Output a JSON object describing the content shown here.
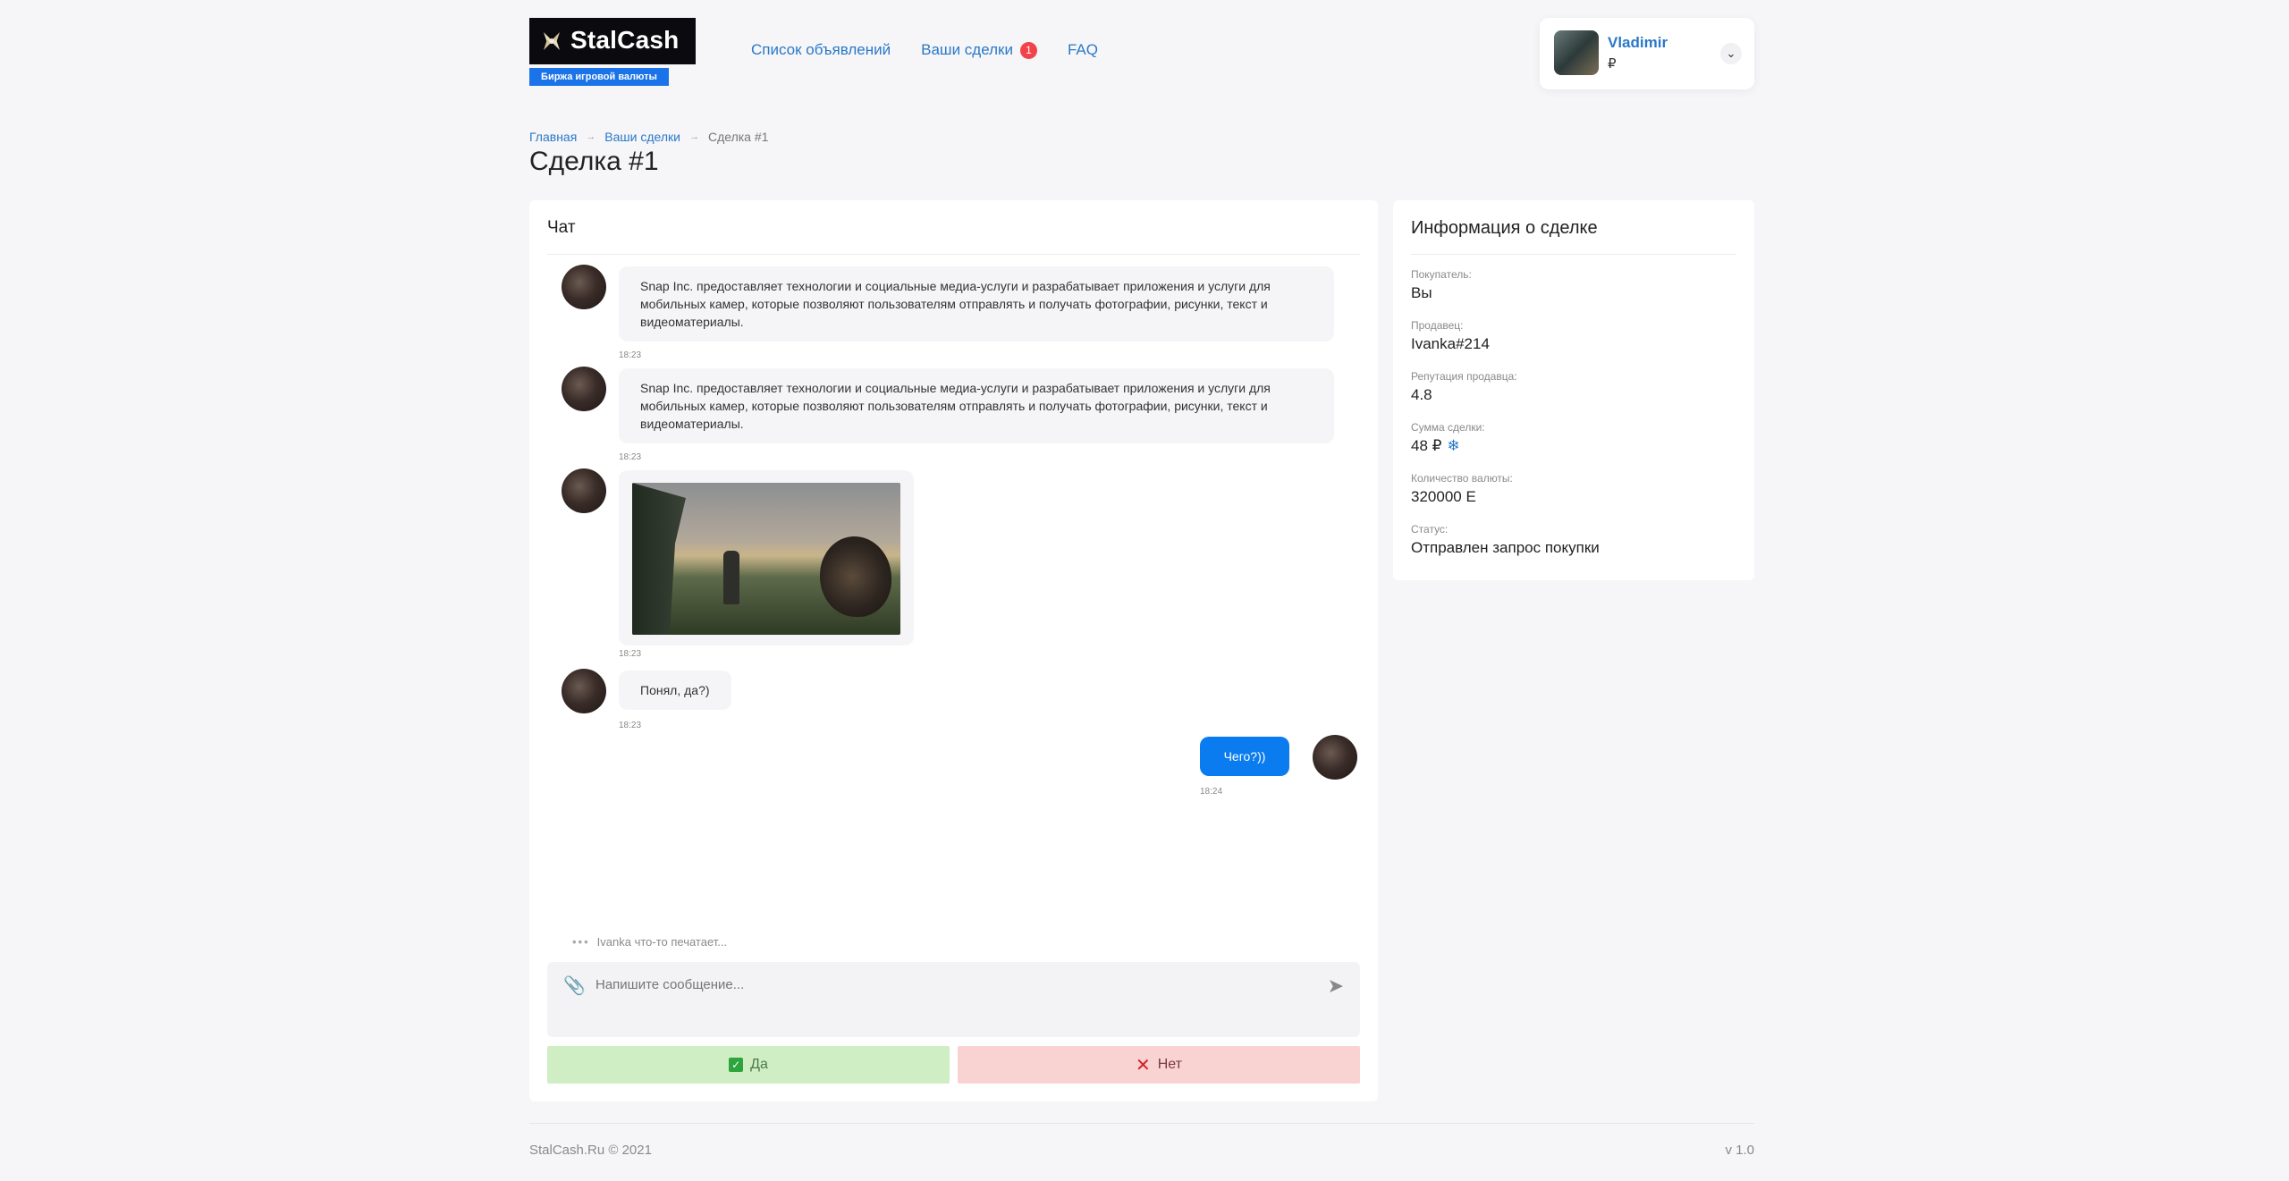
{
  "brand": {
    "name": "StalCash",
    "tagline": "Биржа игровой валюты"
  },
  "nav": {
    "items": [
      {
        "label": "Список объявлений"
      },
      {
        "label": "Ваши сделки",
        "badge": "1"
      },
      {
        "label": "FAQ"
      }
    ]
  },
  "user": {
    "name": "Vladimir",
    "balance": "₽"
  },
  "breadcrumb": {
    "home": "Главная",
    "deals": "Ваши сделки",
    "current": "Сделка #1"
  },
  "page_title": "Сделка #1",
  "chat": {
    "title": "Чат",
    "messages": [
      {
        "text": "Snap Inc. предоставляет технологии и социальные медиа-услуги и разрабатывает приложения и услуги для мобильных камер, которые позволяют пользователям отправлять и получать фотографии, рисунки, текст и видеоматериалы.",
        "time": "18:23"
      },
      {
        "text": "Snap Inc. предоставляет технологии и социальные медиа-услуги и разрабатывает приложения и услуги для мобильных камер, которые позволяют пользователям отправлять и получать фотографии, рисунки, текст и видеоматериалы.",
        "time": "18:23"
      },
      {
        "time": "18:23"
      },
      {
        "text": "Понял, да?)",
        "time": "18:23"
      },
      {
        "text": "Чего?))",
        "time": "18:24"
      }
    ],
    "typing": "Ivanka что-то печатает...",
    "input_placeholder": "Напишите сообщение...",
    "yes_label": "Да",
    "no_label": "Нет"
  },
  "deal_info": {
    "title": "Информация о сделке",
    "buyer_label": "Покупатель:",
    "buyer": "Вы",
    "seller_label": "Продавец:",
    "seller": "Ivanka#214",
    "reputation_label": "Репутация продавца:",
    "reputation": "4.8",
    "amount_label": "Сумма сделки:",
    "amount": "48 ₽",
    "currency_label": "Количество валюты:",
    "currency": "320000 E",
    "status_label": "Статус:",
    "status": "Отправлен запрос покупки"
  },
  "footer": {
    "copyright": "StalCash.Ru © 2021",
    "version": "v 1.0"
  },
  "colors": {
    "accent": "#0a7cf0",
    "link": "#2a78c8",
    "yes_bg": "#cfeec4",
    "no_bg": "#f9d2d2",
    "badge": "#f2424b"
  }
}
